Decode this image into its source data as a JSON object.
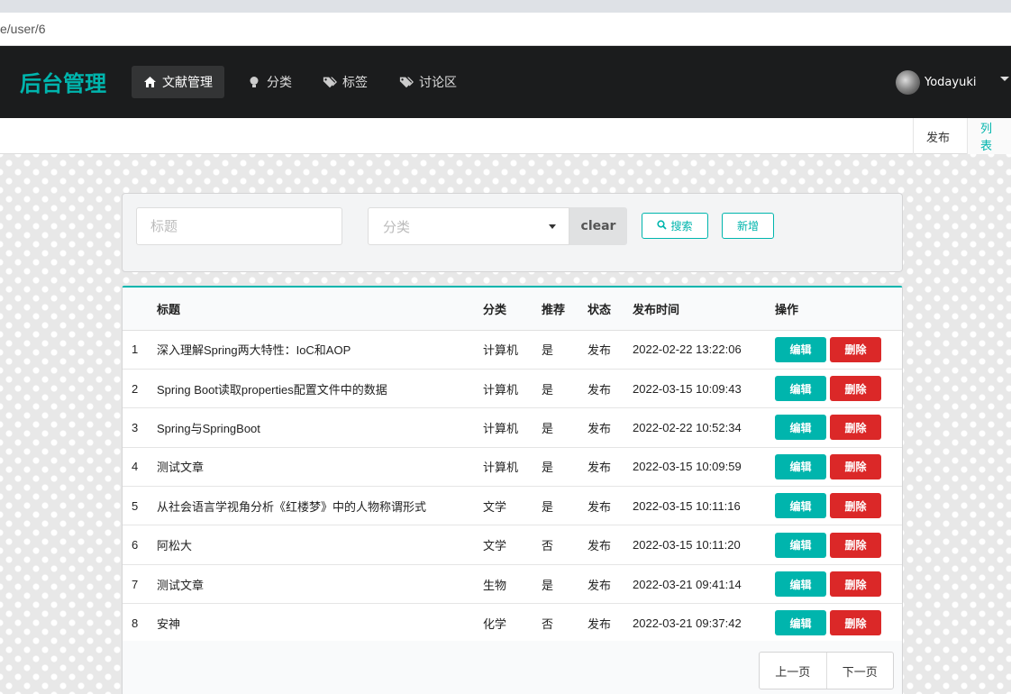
{
  "browser": {
    "url_fragment": "e/user/6"
  },
  "navbar": {
    "brand": "后台管理",
    "items": [
      {
        "label": "文献管理",
        "icon": "home-icon",
        "active": true
      },
      {
        "label": "分类",
        "icon": "lightbulb-icon",
        "active": false
      },
      {
        "label": "标签",
        "icon": "tags-icon",
        "active": false
      },
      {
        "label": "讨论区",
        "icon": "tags-icon",
        "active": false
      }
    ],
    "user": {
      "name": "Yodayuki"
    }
  },
  "subnav": {
    "publish": "发布",
    "list": "列表"
  },
  "search": {
    "title_placeholder": "标题",
    "category_placeholder": "分类",
    "clear_label": "clear",
    "search_label": "搜索",
    "new_label": "新增"
  },
  "table": {
    "headers": {
      "title": "标题",
      "category": "分类",
      "recommend": "推荐",
      "status": "状态",
      "time": "发布时间",
      "actions": "操作"
    },
    "edit_label": "编辑",
    "delete_label": "删除",
    "rows": [
      {
        "idx": "1",
        "title": "深入理解Spring两大特性：IoC和AOP",
        "category": "计算机",
        "recommend": "是",
        "status": "发布",
        "time": "2022-02-22 13:22:06"
      },
      {
        "idx": "2",
        "title": "Spring Boot读取properties配置文件中的数据",
        "category": "计算机",
        "recommend": "是",
        "status": "发布",
        "time": "2022-03-15 10:09:43"
      },
      {
        "idx": "3",
        "title": "Spring与SpringBoot",
        "category": "计算机",
        "recommend": "是",
        "status": "发布",
        "time": "2022-02-22 10:52:34"
      },
      {
        "idx": "4",
        "title": "测试文章",
        "category": "计算机",
        "recommend": "是",
        "status": "发布",
        "time": "2022-03-15 10:09:59"
      },
      {
        "idx": "5",
        "title": "从社会语言学视角分析《红楼梦》中的人物称谓形式",
        "category": "文学",
        "recommend": "是",
        "status": "发布",
        "time": "2022-03-15 10:11:16"
      },
      {
        "idx": "6",
        "title": "阿松大",
        "category": "文学",
        "recommend": "否",
        "status": "发布",
        "time": "2022-03-15 10:11:20"
      },
      {
        "idx": "7",
        "title": "测试文章",
        "category": "生物",
        "recommend": "是",
        "status": "发布",
        "time": "2022-03-21 09:41:14"
      },
      {
        "idx": "8",
        "title": "安神",
        "category": "化学",
        "recommend": "否",
        "status": "发布",
        "time": "2022-03-21 09:37:42"
      }
    ]
  },
  "pager": {
    "prev": "上一页",
    "next": "下一页"
  },
  "colors": {
    "accent": "#00b5ad",
    "danger": "#db2828",
    "navbar": "#1b1c1d"
  }
}
